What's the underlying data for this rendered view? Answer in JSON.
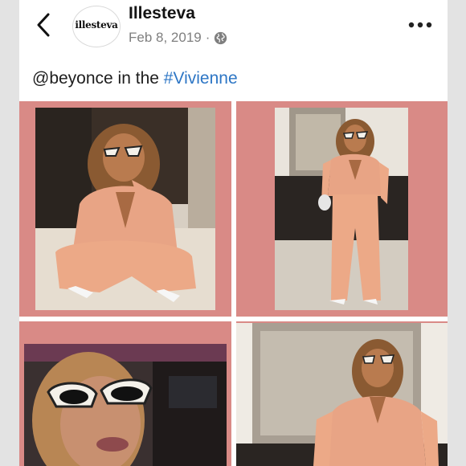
{
  "post": {
    "username": "Illesteva",
    "date": "Feb 8, 2019",
    "separator": "·",
    "privacy_icon": "globe-icon",
    "back_icon": "chevron-left-icon",
    "more_icon": "more-horizontal-icon",
    "avatar_logo": "illesteva",
    "caption_mention": "@beyonce",
    "caption_middle": " in the ",
    "caption_hashtag": "#Vivienne"
  },
  "colors": {
    "tile_background": "#d98a86",
    "hashtag": "#2d76c5",
    "jumpsuit": "#e8a485"
  },
  "photos": [
    {
      "name": "photo-crouching"
    },
    {
      "name": "photo-standing"
    },
    {
      "name": "photo-closeup-selfie"
    },
    {
      "name": "photo-standing-upper"
    }
  ]
}
